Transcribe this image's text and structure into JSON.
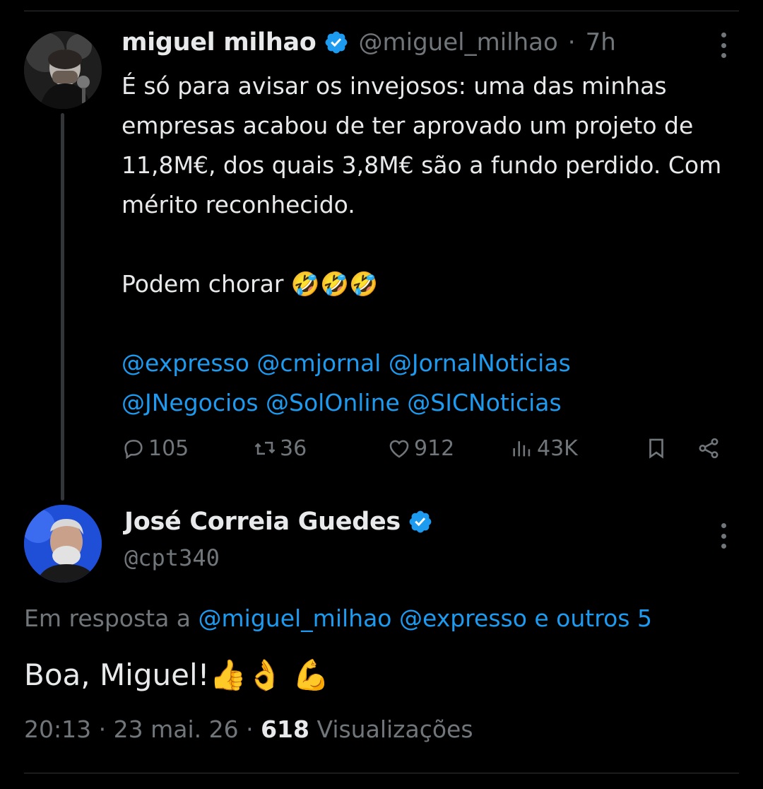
{
  "colors": {
    "background": "#000000",
    "text": "#e7e9ea",
    "muted": "#71767b",
    "link": "#1d9bf0",
    "verified": "#1d9bf0",
    "border": "#2f3336"
  },
  "post1": {
    "author_name": "miguel milhao",
    "handle": "@miguel_milhao",
    "separator": "·",
    "time": "7h",
    "text_paragraph1": "É só para avisar os invejosos: uma das minhas empresas acabou de ter aprovado um projeto de 11,8M€, dos quais 3,8M€ são a fundo perdido. Com mérito reconhecido.",
    "text_paragraph2": "Podem chorar 🤣🤣🤣",
    "mentions_line1": "@expresso @cmjornal @JornalNoticias",
    "mentions_line2": "@JNegocios @SolOnline @SICNoticias",
    "stats": {
      "replies": "105",
      "reposts": "36",
      "likes": "912",
      "views": "43K"
    },
    "icons": [
      "reply-icon",
      "repost-icon",
      "like-icon",
      "views-icon",
      "bookmark-icon",
      "share-icon",
      "more-icon",
      "verified-icon"
    ]
  },
  "post2": {
    "author_name": "José Correia Guedes",
    "handle": "@cpt340",
    "reply_prefix": "Em resposta a",
    "reply_mentions": "@miguel_milhao @expresso e outros 5",
    "text": "Boa, Miguel!👍👌 💪",
    "time": "20:13",
    "date": "23 mai. 26",
    "views_count": "618",
    "views_label": "Visualizações",
    "icons": [
      "verified-icon",
      "more-icon"
    ]
  }
}
